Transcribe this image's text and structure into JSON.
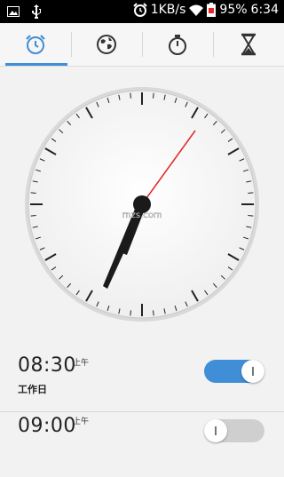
{
  "status_bar": {
    "speed": "1KB/s",
    "battery": "95%",
    "time": "6:34"
  },
  "tabs": [
    {
      "name": "alarm",
      "icon": "alarm-clock-icon",
      "active": true
    },
    {
      "name": "world-clock",
      "icon": "globe-icon",
      "active": false
    },
    {
      "name": "stopwatch",
      "icon": "stopwatch-icon",
      "active": false
    },
    {
      "name": "timer",
      "icon": "hourglass-icon",
      "active": false
    }
  ],
  "clock": {
    "watermark": "rnzs.com"
  },
  "alarms": [
    {
      "time": "08:30",
      "period": "上午",
      "label": "工作日",
      "enabled": true
    },
    {
      "time": "09:00",
      "period": "上午",
      "label": "",
      "enabled": false
    }
  ],
  "colors": {
    "accent": "#3f8ed6",
    "second_hand": "#e02a2a"
  }
}
